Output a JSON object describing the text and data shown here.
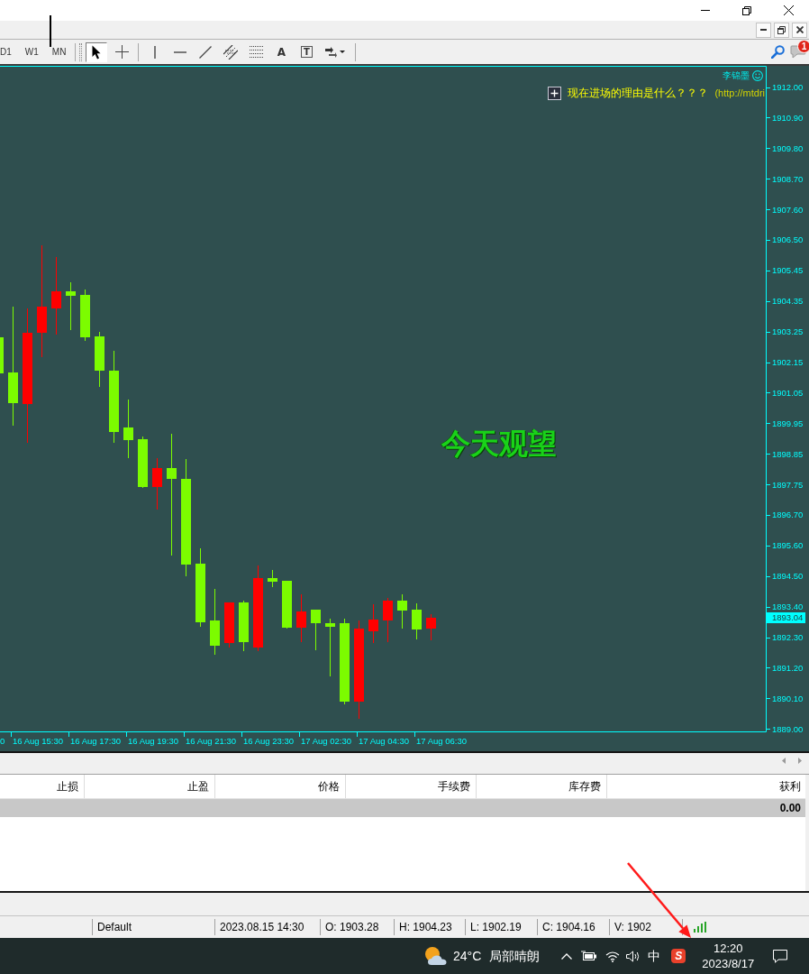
{
  "toolbar": {
    "timeframes": [
      {
        "label": "D1",
        "selected": false
      },
      {
        "label": "W1",
        "selected": false
      },
      {
        "label": "MN",
        "selected": false
      }
    ],
    "tool_groups": [
      {
        "tools": [
          {
            "kind": "cursor",
            "selected": true
          },
          {
            "kind": "crosshair",
            "selected": false
          }
        ]
      },
      {
        "tools": [
          {
            "kind": "vertical-line",
            "selected": false
          },
          {
            "kind": "horizontal-line",
            "selected": false
          },
          {
            "kind": "trendline",
            "selected": false
          },
          {
            "kind": "channel",
            "selected": false
          },
          {
            "kind": "fibonacci",
            "selected": false
          },
          {
            "kind": "text",
            "label": "A",
            "selected": false
          },
          {
            "kind": "text-label",
            "label": "T",
            "selected": false
          },
          {
            "kind": "arrows",
            "selected": false
          }
        ]
      }
    ],
    "notifications": {
      "count": "1"
    }
  },
  "chart": {
    "expert": {
      "name": "李锦墨",
      "enabled": true
    },
    "comment": {
      "text": "现在进场的理由是什么？？？",
      "source": "(http://mtdri"
    },
    "signal": "今天观望",
    "price_axis": [
      "1912.00",
      "1910.90",
      "1909.80",
      "1908.70",
      "1907.60",
      "1906.50",
      "1905.45",
      "1904.35",
      "1903.25",
      "1902.15",
      "1901.05",
      "1899.95",
      "1898.85",
      "1897.75",
      "1896.70",
      "1895.60",
      "1894.50",
      "1893.40",
      "1892.30",
      "1891.20",
      "1890.10",
      "1889.00"
    ],
    "current_price": "1893.04",
    "time_axis": [
      "0",
      "16 Aug 15:30",
      "16 Aug 17:30",
      "16 Aug 19:30",
      "16 Aug 21:30",
      "16 Aug 23:30",
      "17 Aug 02:30",
      "17 Aug 04:30",
      "17 Aug 06:30"
    ]
  },
  "terminal": {
    "columns": [
      "止损",
      "止盈",
      "价格",
      "手续费",
      "库存费",
      "获利"
    ],
    "total": "0.00"
  },
  "status_bar": {
    "cells": [
      "Default",
      "2023.08.15 14:30",
      "O: 1903.28",
      "H: 1904.23",
      "L: 1902.19",
      "C: 1904.16",
      "V: 1902"
    ]
  },
  "taskbar": {
    "weather": {
      "temperature": "24°C",
      "condition": "局部晴朗"
    },
    "input_method": "中",
    "app_logo": "S",
    "time": "12:20",
    "date": "2023/8/17"
  }
}
